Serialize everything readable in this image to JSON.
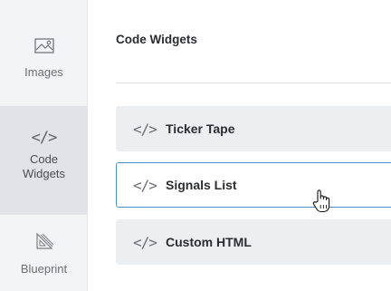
{
  "sidebar": {
    "items": [
      {
        "label": "Images",
        "icon": "image-icon"
      },
      {
        "label": "Code\nWidgets",
        "icon": "code-icon",
        "active": true
      },
      {
        "label": "Blueprint",
        "icon": "blueprint-icon"
      }
    ]
  },
  "main": {
    "title": "Code Widgets",
    "widgets": [
      {
        "glyph": "</>",
        "label": "Ticker Tape"
      },
      {
        "glyph": "</>",
        "label": "Signals List",
        "hovered": true
      },
      {
        "glyph": "</>",
        "label": "Custom HTML"
      }
    ]
  },
  "colors": {
    "sidebar_bg": "#f3f4f6",
    "active_bg": "#e1e3e7",
    "widget_bg": "#edeef0",
    "hover_border": "#4a90c8"
  }
}
